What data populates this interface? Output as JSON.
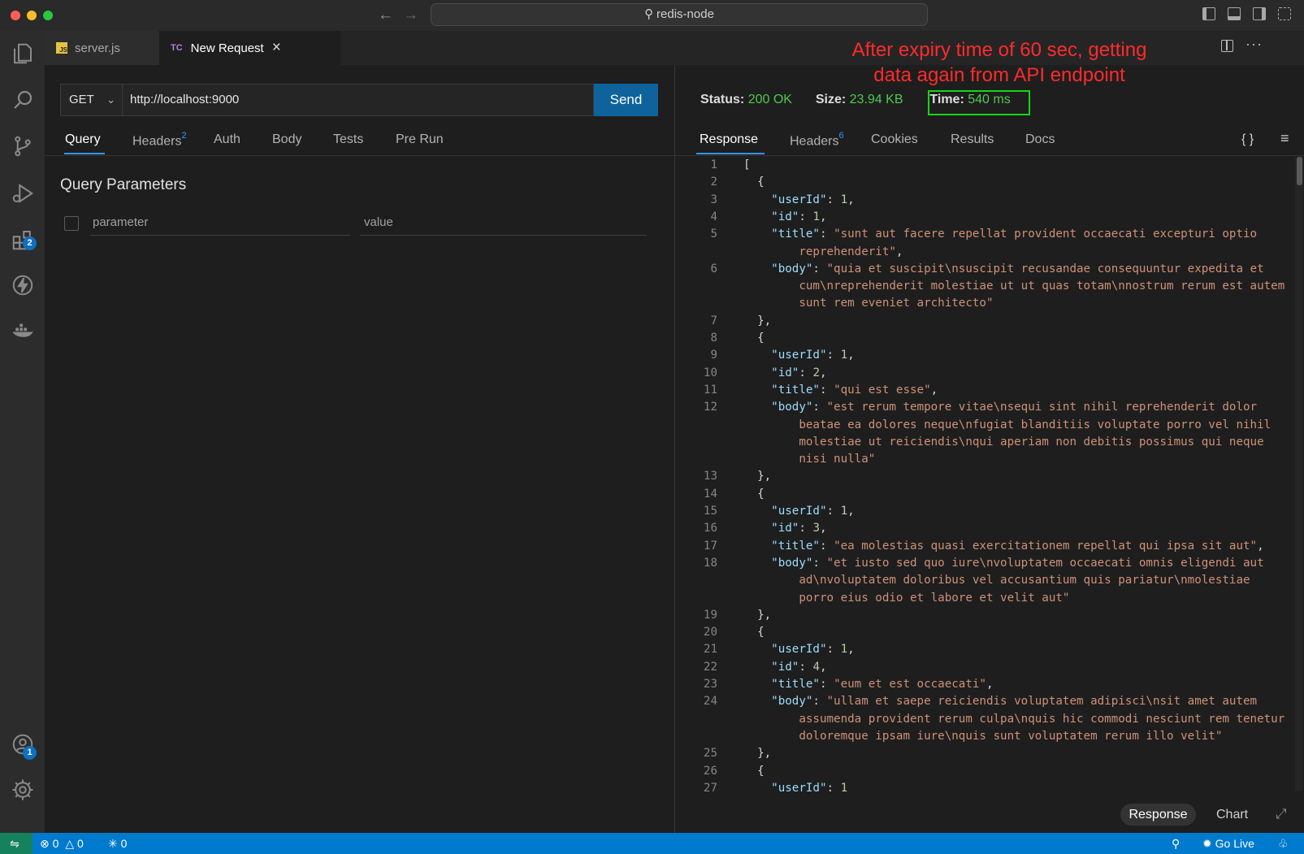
{
  "window": {
    "command_center": "redis-node",
    "annotation_line1": "After expiry time of 60 sec, getting",
    "annotation_line2": "data again from API endpoint"
  },
  "tabs": [
    {
      "label": "server.js",
      "icon": "JS"
    },
    {
      "label": "New Request",
      "icon": "TC"
    }
  ],
  "activity_badges": {
    "extensions": "2",
    "accounts": "1"
  },
  "request": {
    "method": "GET",
    "url": "http://localhost:9000",
    "send_label": "Send",
    "tabs": [
      {
        "label": "Query"
      },
      {
        "label": "Headers",
        "count": "2"
      },
      {
        "label": "Auth"
      },
      {
        "label": "Body"
      },
      {
        "label": "Tests"
      },
      {
        "label": "Pre Run"
      }
    ],
    "query_title": "Query Parameters",
    "param_placeholder": "parameter",
    "value_placeholder": "value"
  },
  "response": {
    "status_label": "Status:",
    "status_value": "200 OK",
    "size_label": "Size:",
    "size_value": "23.94 KB",
    "time_label": "Time:",
    "time_value": "540 ms",
    "tabs": [
      {
        "label": "Response"
      },
      {
        "label": "Headers",
        "count": "6"
      },
      {
        "label": "Cookies"
      },
      {
        "label": "Results"
      },
      {
        "label": "Docs"
      }
    ],
    "braces_icon": "{ }",
    "bottom_response": "Response",
    "bottom_chart": "Chart",
    "lines": [
      {
        "n": "1",
        "text": "["
      },
      {
        "n": "2",
        "text": "  {"
      },
      {
        "n": "3",
        "text": "    \"userId\": 1,"
      },
      {
        "n": "4",
        "text": "    \"id\": 1,"
      },
      {
        "n": "5",
        "text": "    \"title\": \"sunt aut facere repellat provident occaecati excepturi optio"
      },
      {
        "n": "",
        "text": "        reprehenderit\","
      },
      {
        "n": "6",
        "text": "    \"body\": \"quia et suscipit\\nsuscipit recusandae consequuntur expedita et"
      },
      {
        "n": "",
        "text": "        cum\\nreprehenderit molestiae ut ut quas totam\\nnostrum rerum est autem"
      },
      {
        "n": "",
        "text": "        sunt rem eveniet architecto\""
      },
      {
        "n": "7",
        "text": "  },"
      },
      {
        "n": "8",
        "text": "  {"
      },
      {
        "n": "9",
        "text": "    \"userId\": 1,"
      },
      {
        "n": "10",
        "text": "    \"id\": 2,"
      },
      {
        "n": "11",
        "text": "    \"title\": \"qui est esse\","
      },
      {
        "n": "12",
        "text": "    \"body\": \"est rerum tempore vitae\\nsequi sint nihil reprehenderit dolor"
      },
      {
        "n": "",
        "text": "        beatae ea dolores neque\\nfugiat blanditiis voluptate porro vel nihil"
      },
      {
        "n": "",
        "text": "        molestiae ut reiciendis\\nqui aperiam non debitis possimus qui neque"
      },
      {
        "n": "",
        "text": "        nisi nulla\""
      },
      {
        "n": "13",
        "text": "  },"
      },
      {
        "n": "14",
        "text": "  {"
      },
      {
        "n": "15",
        "text": "    \"userId\": 1,"
      },
      {
        "n": "16",
        "text": "    \"id\": 3,"
      },
      {
        "n": "17",
        "text": "    \"title\": \"ea molestias quasi exercitationem repellat qui ipsa sit aut\","
      },
      {
        "n": "18",
        "text": "    \"body\": \"et iusto sed quo iure\\nvoluptatem occaecati omnis eligendi aut"
      },
      {
        "n": "",
        "text": "        ad\\nvoluptatem doloribus vel accusantium quis pariatur\\nmolestiae"
      },
      {
        "n": "",
        "text": "        porro eius odio et labore et velit aut\""
      },
      {
        "n": "19",
        "text": "  },"
      },
      {
        "n": "20",
        "text": "  {"
      },
      {
        "n": "21",
        "text": "    \"userId\": 1,"
      },
      {
        "n": "22",
        "text": "    \"id\": 4,"
      },
      {
        "n": "23",
        "text": "    \"title\": \"eum et est occaecati\","
      },
      {
        "n": "24",
        "text": "    \"body\": \"ullam et saepe reiciendis voluptatem adipisci\\nsit amet autem"
      },
      {
        "n": "",
        "text": "        assumenda provident rerum culpa\\nquis hic commodi nesciunt rem tenetur"
      },
      {
        "n": "",
        "text": "        doloremque ipsam iure\\nquis sunt voluptatem rerum illo velit\""
      },
      {
        "n": "25",
        "text": "  },"
      },
      {
        "n": "26",
        "text": "  {"
      },
      {
        "n": "27",
        "text": "    \"userId\": 1"
      }
    ]
  },
  "statusbar": {
    "errors": "0",
    "warnings": "0",
    "ports": "0",
    "go_live": "Go Live"
  },
  "colors": {
    "accent": "#007acc",
    "send": "#0e639c",
    "ok_green": "#4ec94e",
    "annotation_red": "#ff2b2b",
    "highlight_box": "#18d418"
  }
}
